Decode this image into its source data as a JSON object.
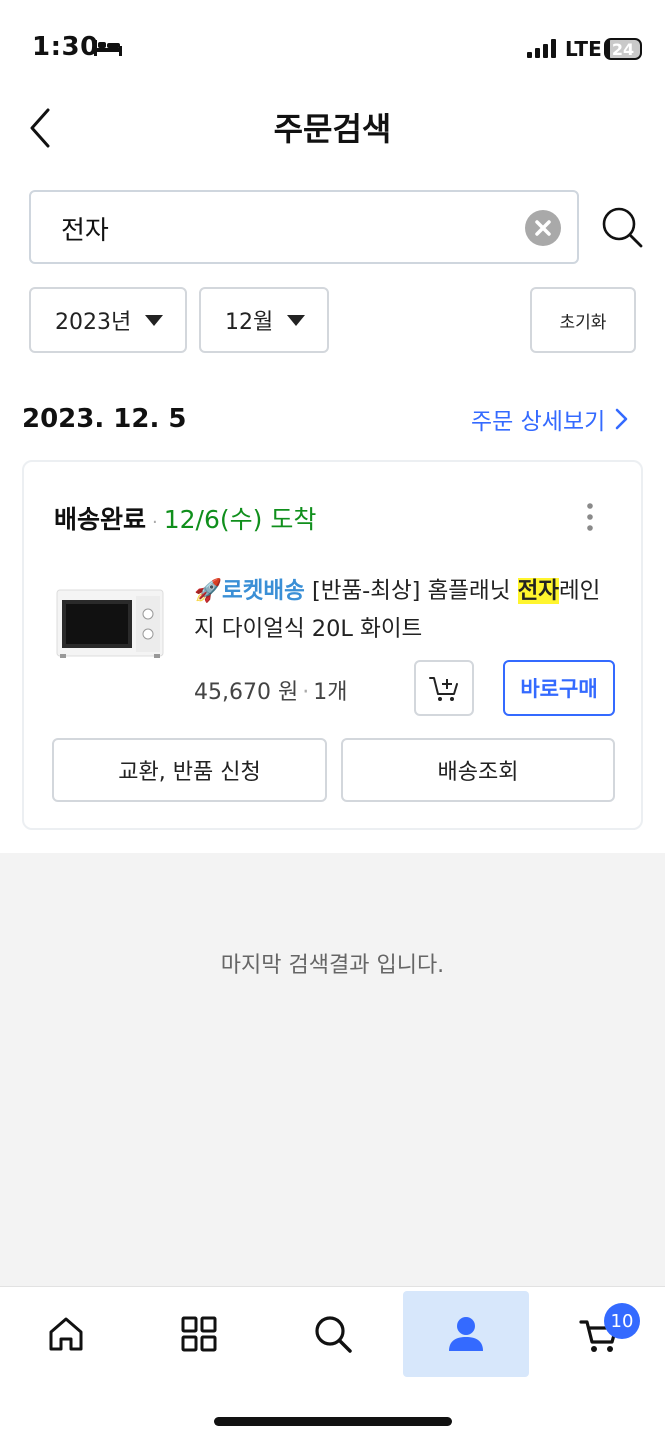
{
  "status_bar": {
    "time": "1:30",
    "network": "LTE",
    "battery": "24"
  },
  "header": {
    "title": "주문검색"
  },
  "search": {
    "value": "전자"
  },
  "filters": {
    "year": "2023년",
    "month": "12월",
    "reset_label": "초기화"
  },
  "order": {
    "date": "2023. 12. 5",
    "detail_link": "주문 상세보기",
    "status": "배송완료",
    "arrival": "12/6(수) 도착",
    "product": {
      "badge": "로켓배송",
      "title_prefix": " [반품-최상] 홈플래닛 ",
      "title_highlight": "전자",
      "title_suffix": "레인지 다이얼식 20L 화이트"
    },
    "price": "45,670 원",
    "quantity": "1개",
    "buy_now_label": "바로구매",
    "return_label": "교환, 반품 신청",
    "tracking_label": "배송조회"
  },
  "end_message": "마지막 검색결과 입니다.",
  "bottom_nav": {
    "items": [
      {
        "name": "home",
        "icon": "home-icon"
      },
      {
        "name": "category",
        "icon": "grid-icon"
      },
      {
        "name": "search",
        "icon": "search-icon"
      },
      {
        "name": "my",
        "icon": "person-icon",
        "active": true
      },
      {
        "name": "cart",
        "icon": "cart-icon"
      }
    ],
    "cart_count": "10"
  },
  "colors": {
    "accent": "#346aff",
    "success": "#108f1c",
    "highlight": "#fff52e",
    "active_tab": "#d7e7fb"
  }
}
